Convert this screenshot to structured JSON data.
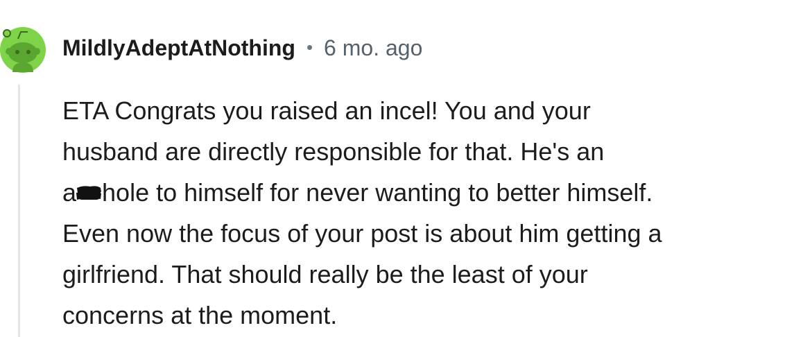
{
  "comment": {
    "username": "MildlyAdeptAtNothing",
    "separator": "•",
    "timestamp": "6 mo. ago",
    "avatar_icon": "reddit-snoo-avatar-icon",
    "avatar_color": "#7ed348",
    "body_lines": [
      "ETA Congrats you raised an incel! You and your",
      "husband are directly responsible for that. He's an",
      {
        "before": "a",
        "after": "hole to himself for never wanting to better himself."
      },
      "Even now the focus of your post is about him getting a",
      "girlfriend. That should really be the least of your",
      "concerns at the moment."
    ]
  }
}
